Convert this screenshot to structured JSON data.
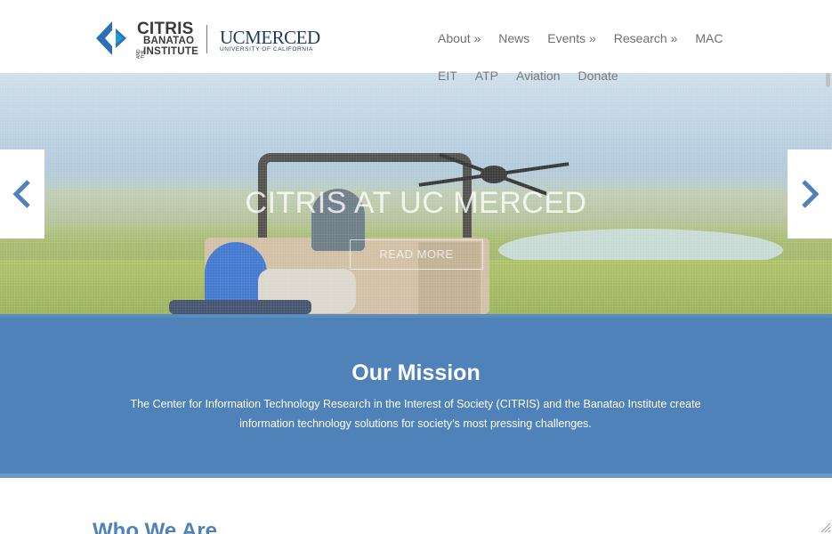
{
  "header": {
    "logo": {
      "citris": "CITRIS",
      "and": "AND THE",
      "banatao": "BANATAO",
      "institute": "INSTITUTE",
      "ucmerced": "UCMERCED",
      "uc_sub": "UNIVERSITY OF CALIFORNIA"
    },
    "nav_row1": [
      "About »",
      "News",
      "Events »",
      "Research »",
      "MAC"
    ],
    "nav_row2": [
      "EIT",
      "ATP",
      "Aviation",
      "Donate"
    ]
  },
  "hero": {
    "title": "CITRIS AT UC MERCED",
    "button": "READ MORE"
  },
  "mission": {
    "title": "Our Mission",
    "text": "The Center for Information Technology Research in the Interest of Society (CITRIS) and the Banatao Institute create information technology solutions for society’s most pressing challenges."
  },
  "who": {
    "title": "Who We Are"
  },
  "colors": {
    "accent": "#4f82b8",
    "logo_blue": "#2d6fb6",
    "nav_text": "#6f6f6f"
  },
  "icons": {
    "prev": "chevron-left-icon",
    "next": "chevron-right-icon",
    "logo_mark": "citris-chevron-logo-icon"
  }
}
